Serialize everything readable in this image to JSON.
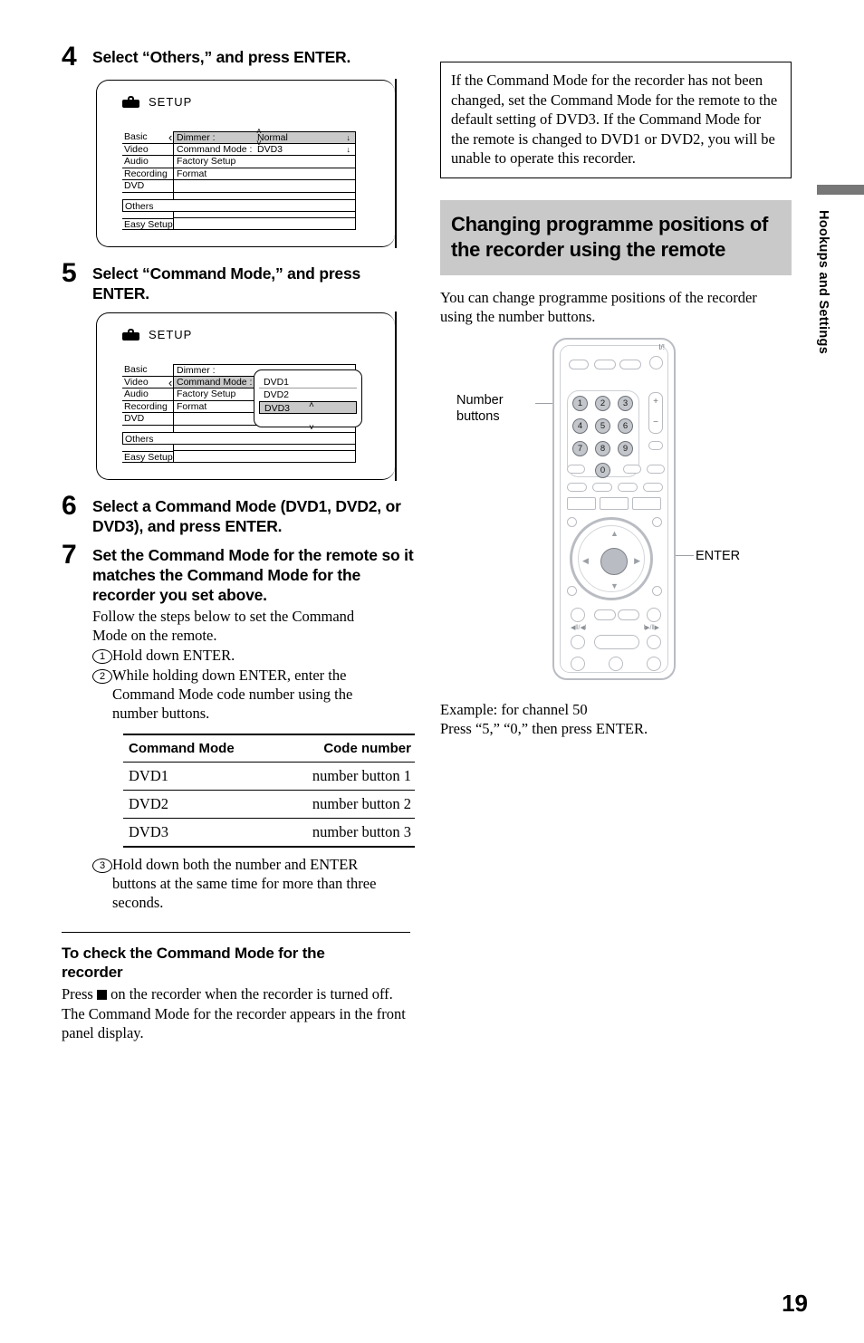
{
  "page_number": "19",
  "side_tab": "Hookups and Settings",
  "left_column": {
    "step4": {
      "number": "4",
      "title": "Select “Others,” and press ENTER."
    },
    "step5": {
      "number": "5",
      "title": "Select “Command Mode,” and press ENTER."
    },
    "step6": {
      "number": "6",
      "title": "Select a Command Mode (DVD1, DVD2, or DVD3), and press ENTER."
    },
    "step7": {
      "number": "7",
      "title": "Set the Command Mode for the remote so it matches the Command Mode for the recorder you set above.",
      "intro": "Follow the steps below to set the Command Mode on the remote.",
      "substeps": [
        {
          "num": "1",
          "text": "Hold down ENTER."
        },
        {
          "num": "2",
          "text": "While holding down ENTER, enter the Command Mode code number using the number buttons."
        },
        {
          "num": "3",
          "text": "Hold down both the number and ENTER buttons at the same time for more than three seconds."
        }
      ]
    },
    "table": {
      "headers": [
        "Command Mode",
        "Code number"
      ],
      "rows": [
        [
          "DVD1",
          "number button 1"
        ],
        [
          "DVD2",
          "number button 2"
        ],
        [
          "DVD3",
          "number button 3"
        ]
      ]
    },
    "check_section": {
      "heading": "To check the Command Mode for the recorder",
      "text_before": "Press",
      "text_after": "on the recorder when the recorder is turned off. The Command Mode for the recorder appears in the front panel display."
    }
  },
  "osd_screen_1": {
    "title": "SETUP",
    "left_menu": [
      "Basic",
      "Video",
      "Audio",
      "Recording",
      "DVD"
    ],
    "wide_item": "Others",
    "bottom_item": "Easy Setup",
    "rows": [
      {
        "label": "Dimmer :",
        "value": "Normal",
        "arrow": "↓",
        "highlight": true
      },
      {
        "label": "Command Mode :",
        "value": "DVD3",
        "arrow": "↓",
        "highlight": false
      },
      {
        "label": "Factory Setup",
        "value": "",
        "arrow": "",
        "highlight": false
      },
      {
        "label": "Format",
        "value": "",
        "arrow": "",
        "highlight": false
      },
      {
        "label": "",
        "value": "",
        "arrow": "",
        "highlight": false
      }
    ],
    "caret": "‹"
  },
  "osd_screen_2": {
    "title": "SETUP",
    "left_menu": [
      "Basic",
      "Video",
      "Audio",
      "Recording",
      "DVD"
    ],
    "wide_item": "Others",
    "bottom_item": "Easy Setup",
    "rows": [
      {
        "label": "Dimmer :",
        "highlight": false
      },
      {
        "label": "Command Mode :",
        "highlight": true
      },
      {
        "label": "Factory Setup",
        "highlight": false
      },
      {
        "label": "Format",
        "highlight": false
      },
      {
        "label": "",
        "highlight": false
      }
    ],
    "popup_options": [
      "DVD1",
      "DVD2",
      "DVD3"
    ],
    "popup_selected": "DVD3",
    "caret": "‹"
  },
  "right_column": {
    "note": "If the Command Mode for the recorder has not been changed, set the Command Mode for the remote to the default setting of DVD3. If the Command Mode for the remote is changed to DVD1 or DVD2, you will be unable to operate this recorder.",
    "section_heading": "Changing programme positions of the recorder using the remote",
    "section_intro": "You can change programme positions of the recorder using the number buttons.",
    "callout_number_buttons": "Number buttons",
    "callout_enter": "ENTER",
    "example_line1": "Example: for channel 50",
    "example_line2": "Press “5,” “0,” then press ENTER."
  },
  "remote": {
    "number_keys": [
      "1",
      "2",
      "3",
      "4",
      "5",
      "6",
      "7",
      "8",
      "9",
      "0"
    ],
    "power_label": "I/ǃ",
    "volume_plus": "+",
    "volume_minus": "−",
    "transport_left_label": "◀ll/◀l",
    "transport_right_label": "l▶/ll▶"
  },
  "colors": {
    "highlight_gray": "#c9c9c9",
    "tab_gray": "#777777",
    "remote_outline": "#b9bcc2",
    "key_fill": "#c3c6cb"
  }
}
